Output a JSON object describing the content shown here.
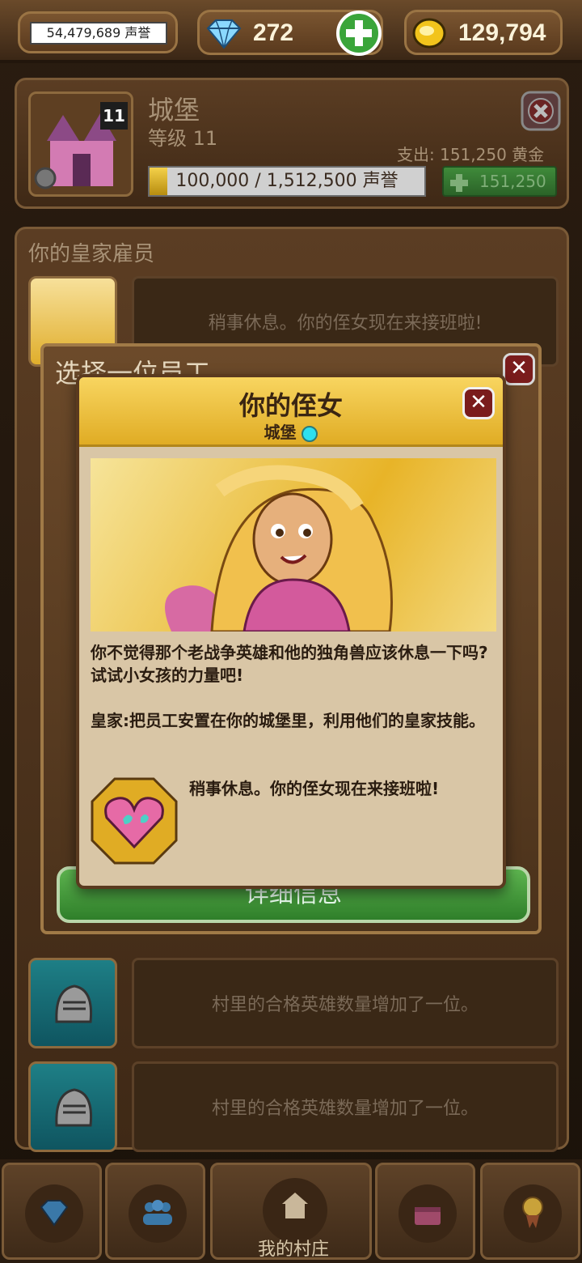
{
  "topbar": {
    "reputation": "54,479,689 声誉",
    "gems": "272",
    "gold": "129,794"
  },
  "castle": {
    "title": "城堡",
    "level_badge": "11",
    "level_text": "等级 11",
    "spend": "支出: 151,250 黄金",
    "progress_text": "100,000 / 1,512,500 声誉",
    "progress_fraction": 0.066,
    "upgrade_cost": "151,250"
  },
  "employees": {
    "title": "你的皇家雇员",
    "rows": [
      {
        "text": "稍事休息。你的侄女现在来接班啦!"
      },
      {
        "text": "村里的合格英雄数量增加了一位。"
      },
      {
        "text": "村里的合格英雄数量增加了一位。"
      }
    ]
  },
  "select_dialog": {
    "title": "选择一位员工",
    "details_button": "详细信息"
  },
  "niece_dialog": {
    "title": "你的侄女",
    "subtitle": "城堡",
    "description": "你不觉得那个老战争英雄和他的独角兽应该休息一下吗?试试小女孩的力量吧!",
    "royal_skill": "皇家:把员工安置在你的城堡里，利用他们的皇家技能。",
    "perk": "稍事休息。你的侄女现在来接班啦!"
  },
  "nav": {
    "village_label": "我的村庄"
  },
  "colors": {
    "accent_gold": "#e0ac24",
    "panel_wood": "#4b321b",
    "button_green": "#2f7f2a",
    "close_red": "#7a1c1c"
  }
}
